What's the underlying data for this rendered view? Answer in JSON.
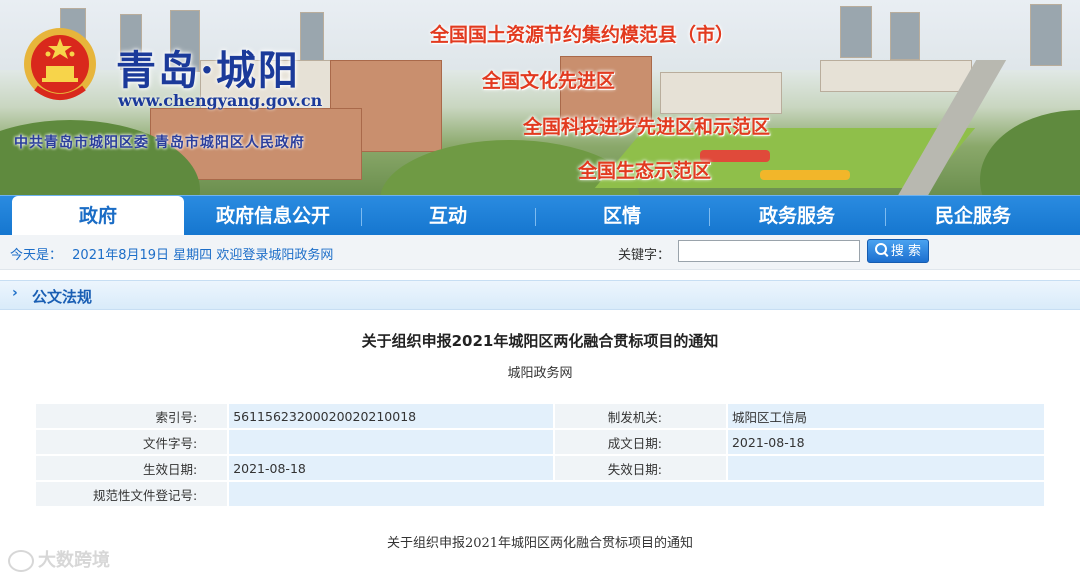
{
  "banner": {
    "site_name": "青岛·城阳",
    "site_url": "www.chengyang.gov.cn",
    "site_org": "中共青岛市城阳区委  青岛市城阳区人民政府",
    "slogans": [
      "全国国土资源节约集约模范县（市）",
      "全国文化先进区",
      "全国科技进步先进区和示范区",
      "全国生态示范区"
    ]
  },
  "nav": {
    "items": [
      "政府",
      "政府信息公开",
      "互动",
      "区情",
      "政务服务",
      "民企服务"
    ],
    "active": "政府"
  },
  "infobar": {
    "today_label": "今天是：",
    "today_value": "2021年8月19日 星期四 欢迎登录城阳政务网",
    "keyword_label": "关键字：",
    "keyword_value": "",
    "search_label": "搜 索"
  },
  "section": {
    "title": "公文法规"
  },
  "doc": {
    "title": "关于组织申报2021年城阳区两化融合贯标项目的通知",
    "source": "城阳政务网",
    "meta": {
      "index_label": "索引号:",
      "index_value": "5611562320002002021001​8",
      "issuer_label": "制发机关:",
      "issuer_value": "城阳区工信局",
      "docno_label": "文件字号:",
      "docno_value": "",
      "date_label": "成文日期:",
      "date_value": "2021-08-18",
      "effective_label": "生效日期:",
      "effective_value": "2021-08-18",
      "expire_label": "失效日期:",
      "expire_value": "",
      "reg_label": "规范性文件登记号:",
      "reg_value": ""
    },
    "body_title": "关于组织申报2021年城阳区两化融合贯标项目的通知"
  },
  "watermark": "大数跨境",
  "colors": {
    "nav_blue": "#1576cf",
    "link_blue": "#1d6ec8",
    "slogan_red": "#e23a1f"
  }
}
